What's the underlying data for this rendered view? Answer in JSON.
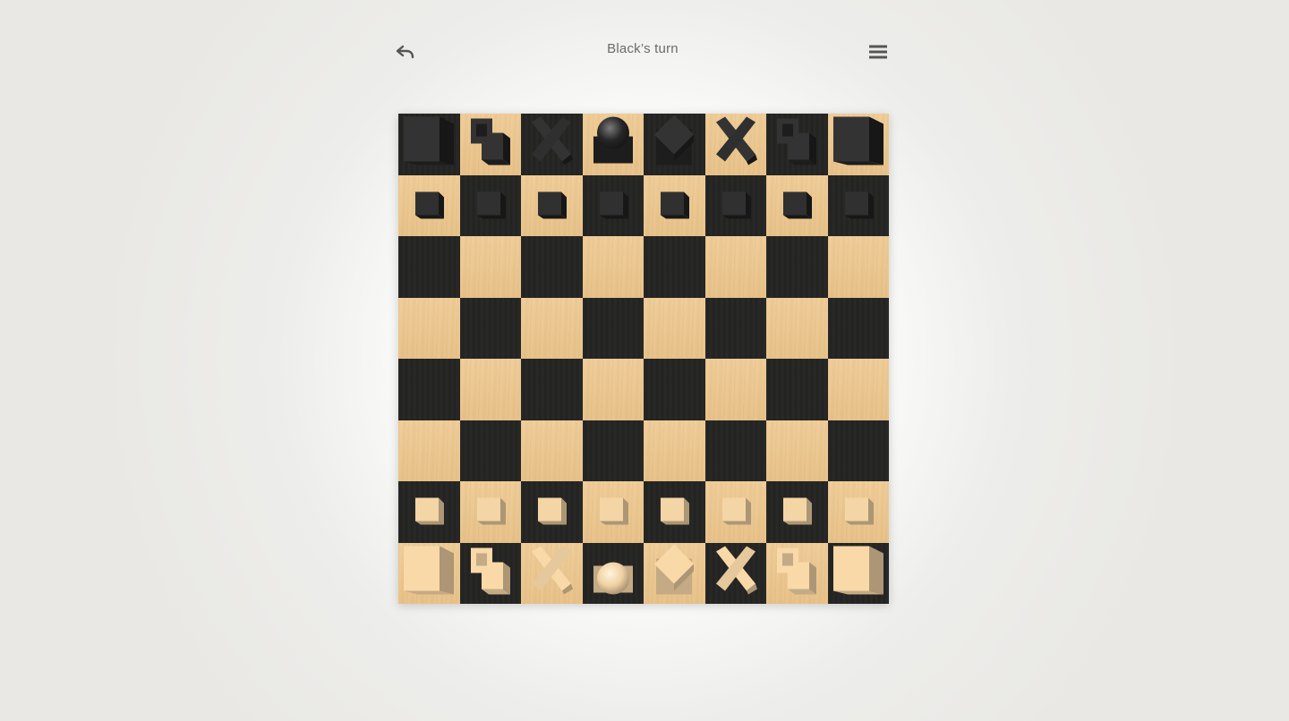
{
  "header": {
    "turn_label": "Black’s turn",
    "undo_icon": "undo-icon",
    "menu_icon": "hamburger-menu-icon"
  },
  "colors": {
    "light_square": "#f1cf9b",
    "dark_square": "#222221",
    "black_piece": "#262626",
    "white_piece": "#efd1a2"
  },
  "board": {
    "ranks": [
      [
        "R",
        "N",
        "B",
        "Q",
        "K",
        "B",
        "N",
        "R"
      ],
      [
        "P",
        "P",
        "P",
        "P",
        "P",
        "P",
        "P",
        "P"
      ],
      [
        "",
        "",
        "",
        "",
        "",
        "",
        "",
        ""
      ],
      [
        "",
        "",
        "",
        "",
        "",
        "",
        "",
        ""
      ],
      [
        "",
        "",
        "",
        "",
        "",
        "",
        "",
        ""
      ],
      [
        "",
        "",
        "",
        "",
        "",
        "",
        "",
        ""
      ],
      [
        "P",
        "P",
        "P",
        "P",
        "P",
        "P",
        "P",
        "P"
      ],
      [
        "R",
        "N",
        "B",
        "Q",
        "K",
        "B",
        "N",
        "R"
      ]
    ],
    "piece_colors": [
      "black",
      "black",
      "",
      "",
      "",
      "",
      "white",
      "white"
    ]
  }
}
